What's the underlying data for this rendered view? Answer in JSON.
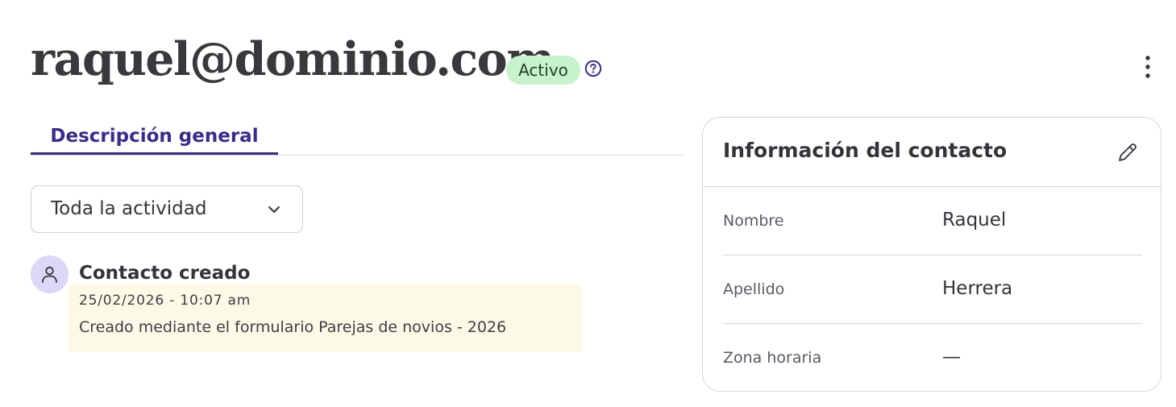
{
  "header": {
    "email": "raquel@dominio.com",
    "status": "Activo",
    "help_icon": "help-circle-icon",
    "more_icon": "more-vertical-icon"
  },
  "tabs": [
    {
      "label": "Descripción general",
      "active": true
    }
  ],
  "activity_filter": {
    "selected": "Toda la actividad",
    "icon": "chevron-down-icon"
  },
  "timeline": [
    {
      "icon": "person-icon",
      "title": "Contacto creado",
      "date": "25/02/2026 - 10:07 am",
      "description": "Creado mediante el formulario Parejas de novios - 2026"
    }
  ],
  "contact_card": {
    "title": "Información del contacto",
    "edit_icon": "pencil-icon",
    "fields": [
      {
        "label": "Nombre",
        "value": "Raquel"
      },
      {
        "label": "Apellido",
        "value": "Herrera"
      },
      {
        "label": "Zona horaria",
        "value": "—"
      }
    ]
  },
  "colors": {
    "accent": "#3c2a8b",
    "status_bg": "#c6f2cc",
    "highlight_bg": "#fdf9e7",
    "avatar_bg": "#dcd7f6"
  }
}
